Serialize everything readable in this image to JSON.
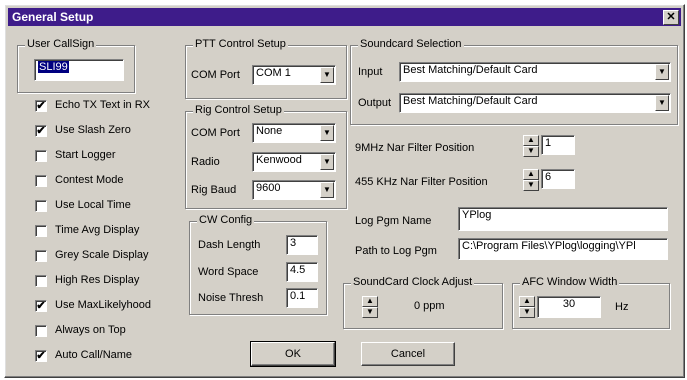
{
  "window": {
    "title": "General Setup",
    "close_glyph": "✕"
  },
  "user_callsign": {
    "legend": "User CallSign",
    "value": "SLI99"
  },
  "checkboxes": [
    {
      "label": "Echo TX Text in RX",
      "checked": true
    },
    {
      "label": "Use Slash Zero",
      "checked": true
    },
    {
      "label": "Start Logger",
      "checked": false
    },
    {
      "label": "Contest Mode",
      "checked": false
    },
    {
      "label": "Use Local Time",
      "checked": false
    },
    {
      "label": "Time Avg Display",
      "checked": false
    },
    {
      "label": "Grey Scale Display",
      "checked": false
    },
    {
      "label": "High Res Display",
      "checked": false
    },
    {
      "label": "Use MaxLikelyhood",
      "checked": true
    },
    {
      "label": "Always on Top",
      "checked": false
    },
    {
      "label": "Auto Call/Name",
      "checked": true
    }
  ],
  "ptt": {
    "legend": "PTT Control Setup",
    "com_port_label": "COM Port",
    "com_port_value": "COM 1"
  },
  "rig": {
    "legend": "Rig Control Setup",
    "com_port_label": "COM Port",
    "com_port_value": "None",
    "radio_label": "Radio",
    "radio_value": "Kenwood",
    "baud_label": "Rig Baud",
    "baud_value": "9600"
  },
  "cw": {
    "legend": "CW Config",
    "dash_label": "Dash Length",
    "dash_value": "3",
    "word_label": "Word Space",
    "word_value": "4.5",
    "noise_label": "Noise Thresh",
    "noise_value": "0.1"
  },
  "soundcard": {
    "legend": "Soundcard Selection",
    "input_label": "Input",
    "input_value": "Best Matching/Default Card",
    "output_label": "Output",
    "output_value": "Best Matching/Default Card"
  },
  "filters": {
    "mhz_label": "9MHz Nar Filter Position",
    "mhz_value": "1",
    "khz_label": "455 KHz Nar Filter Position",
    "khz_value": "6"
  },
  "log": {
    "name_label": "Log Pgm Name",
    "name_value": "YPlog",
    "path_label": "Path to Log Pgm",
    "path_value": "C:\\Program Files\\YPlog\\logging\\YPl"
  },
  "clock": {
    "legend": "SoundCard Clock Adjust",
    "value": "0 ppm"
  },
  "afc": {
    "legend": "AFC Window Width",
    "value": "30",
    "unit": "Hz"
  },
  "buttons": {
    "ok": "OK",
    "cancel": "Cancel"
  },
  "glyphs": {
    "down_arrow": "▼",
    "spin_up": "▲",
    "spin_down": "▼",
    "check": "✔"
  }
}
